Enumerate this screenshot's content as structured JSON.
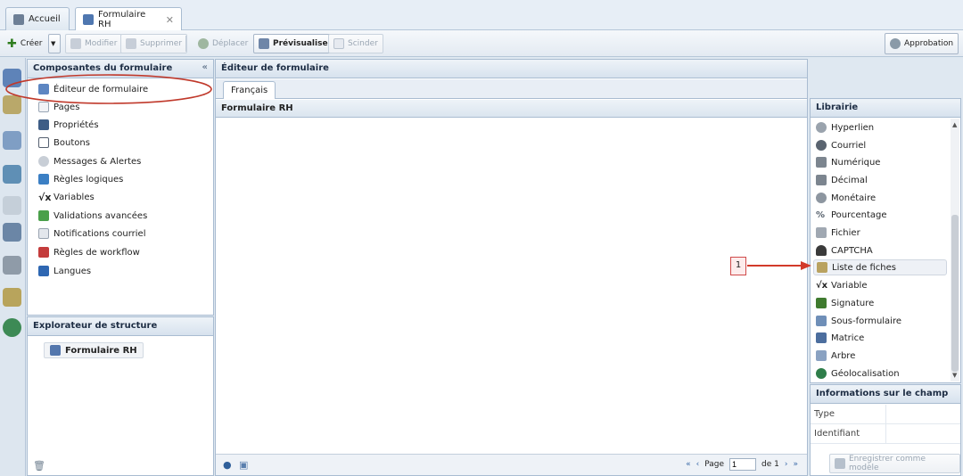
{
  "tabs": [
    {
      "label": "Accueil",
      "icon": "home-icon"
    },
    {
      "label": "Formulaire RH",
      "icon": "form-icon",
      "close": "✕"
    }
  ],
  "toolbar": {
    "creer": "Créer",
    "modifier": "Modifier",
    "supprimer": "Supprimer",
    "deplacer": "Déplacer",
    "previsualiser": "Prévisualiser",
    "scinder": "Scinder",
    "approbation": "Approbation"
  },
  "components": {
    "title": "Composantes du formulaire",
    "items": [
      "Éditeur de formulaire",
      "Pages",
      "Propriétés",
      "Boutons",
      "Messages & Alertes",
      "Règles logiques",
      "Variables",
      "Validations avancées",
      "Notifications courriel",
      "Règles de workflow",
      "Langues"
    ]
  },
  "structure": {
    "title": "Explorateur de structure",
    "root": "Formulaire RH"
  },
  "editor": {
    "title": "Éditeur de formulaire",
    "lang_tab": "Français",
    "form_title": "Formulaire RH",
    "pager": {
      "page_label": "Page",
      "page_value": "1",
      "of_label": "de 1"
    }
  },
  "library": {
    "title": "Librairie",
    "items": [
      "Hyperlien",
      "Courriel",
      "Numérique",
      "Décimal",
      "Monétaire",
      "Pourcentage",
      "Fichier",
      "CAPTCHA",
      "Liste de fiches",
      "Variable",
      "Signature",
      "Sous-formulaire",
      "Matrice",
      "Arbre",
      "Géolocalisation"
    ],
    "selected_index": 8
  },
  "field_info": {
    "title": "Informations sur le champ",
    "rows": [
      {
        "label": "Type",
        "value": ""
      },
      {
        "label": "Identifiant",
        "value": ""
      }
    ],
    "save_as_template": "Enregistrer comme modèle"
  },
  "callout": {
    "label": "1"
  },
  "colors": {
    "highlight_ellipse": "#c0392b",
    "callout_border": "#d04a4a",
    "callout_fill": "#fdecec",
    "arrow": "#d23a2a"
  }
}
